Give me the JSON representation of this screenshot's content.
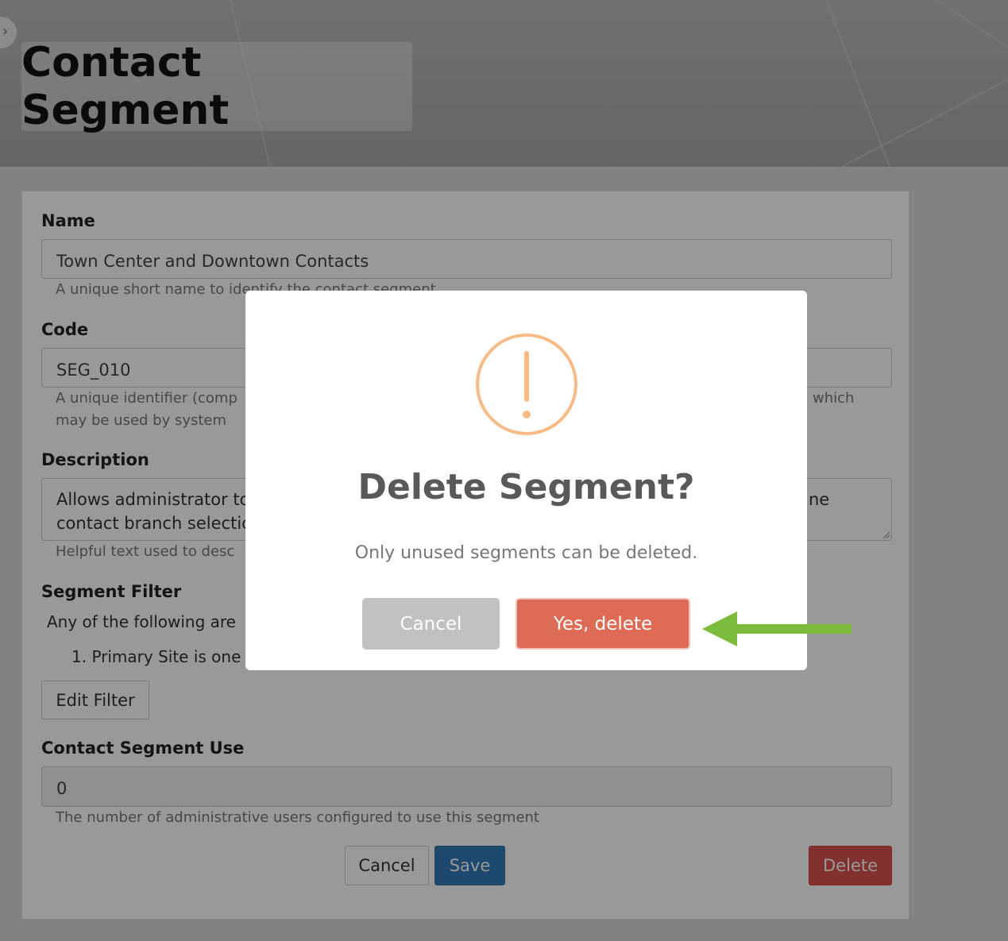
{
  "header": {
    "title": "Contact Segment"
  },
  "form": {
    "name": {
      "label": "Name",
      "value": "Town Center and Downtown Contacts",
      "help": "A unique short name to identify the contact segment"
    },
    "code": {
      "label": "Code",
      "value": "SEG_010",
      "help_line1_left": "A unique identifier (comp",
      "help_line1_right": "which",
      "help_line2": "may be used by system"
    },
    "description": {
      "label": "Description",
      "line1_left": "Allows administrator to",
      "line1_right": "ne",
      "line2": "contact branch selectio",
      "help": "Helpful text used to desc"
    },
    "segment_filter": {
      "label": "Segment Filter",
      "intro": "Any of the following are",
      "item1": "1.  Primary Site is one",
      "edit_button": "Edit Filter"
    },
    "usage": {
      "label": "Contact Segment Use",
      "value": "0",
      "help": "The number of administrative users configured to use this segment"
    },
    "buttons": {
      "cancel": "Cancel",
      "save": "Save",
      "delete": "Delete"
    }
  },
  "modal": {
    "title": "Delete Segment?",
    "text": "Only unused segments can be deleted.",
    "cancel": "Cancel",
    "confirm": "Yes, delete"
  },
  "colors": {
    "warning": "#f8bb86",
    "confirm": "#dd6b55",
    "arrow": "#7dbb3c",
    "primary": "#337ab7",
    "danger": "#d9534f"
  }
}
